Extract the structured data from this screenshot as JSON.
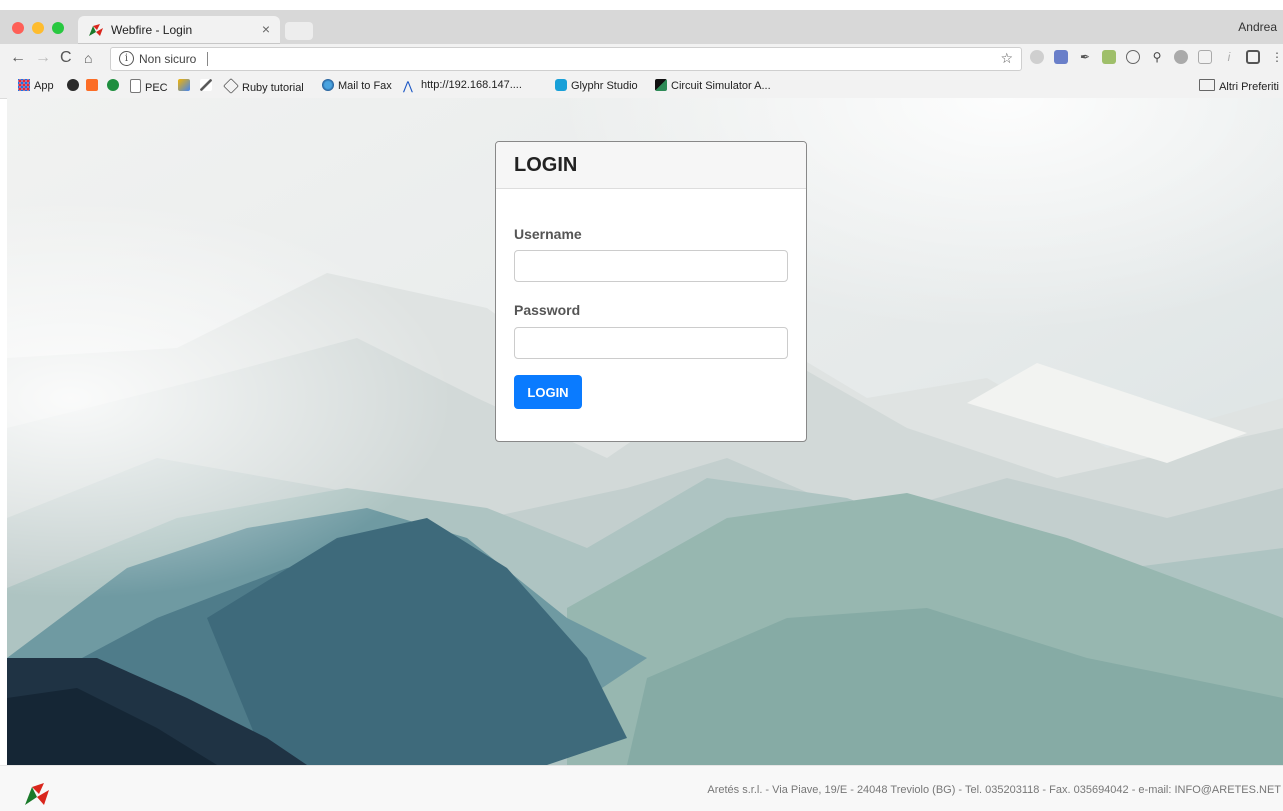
{
  "browser": {
    "tab_title": "Webfire - Login",
    "tab_close": "×",
    "profile_name": "Andrea",
    "url_security_label": "Non sicuro",
    "info_glyph": "i",
    "nav": {
      "back": "←",
      "forward": "→",
      "reload": "C",
      "home": "⌂"
    },
    "star_glyph": "☆",
    "bookmarks": [
      {
        "label": "App",
        "icon": "apps-grid-icon"
      },
      {
        "label": "",
        "icon": "gamepad-icon"
      },
      {
        "label": "",
        "icon": "gitlab-icon"
      },
      {
        "label": "",
        "icon": "info-bookmark-icon"
      },
      {
        "label": "PEC",
        "icon": "page-icon"
      },
      {
        "label": "",
        "icon": "feed-icon"
      },
      {
        "label": "",
        "icon": "pen-icon"
      },
      {
        "label": "Ruby tutorial",
        "icon": "diamond-icon"
      },
      {
        "label": "Mail to Fax",
        "icon": "globe-icon"
      },
      {
        "label": "http://192.168.147....",
        "icon": "wave-icon"
      },
      {
        "label": "Glyphr Studio",
        "icon": "glyphr-icon"
      },
      {
        "label": "Circuit Simulator A...",
        "icon": "circuit-icon"
      }
    ],
    "other_bookmarks": "Altri Preferiti"
  },
  "login": {
    "title": "LOGIN",
    "username_label": "Username",
    "username_value": "",
    "password_label": "Password",
    "password_value": "",
    "submit_label": "LOGIN"
  },
  "footer": {
    "text": "Aretés s.r.l. - Via Piave, 19/E - 24048 Treviolo (BG) - Tel. 035203118 - Fax. 035694042 - e-mail: INFO@ARETES.NET"
  },
  "colors": {
    "primary_button": "#0a7bff",
    "footer_text": "#777777"
  }
}
